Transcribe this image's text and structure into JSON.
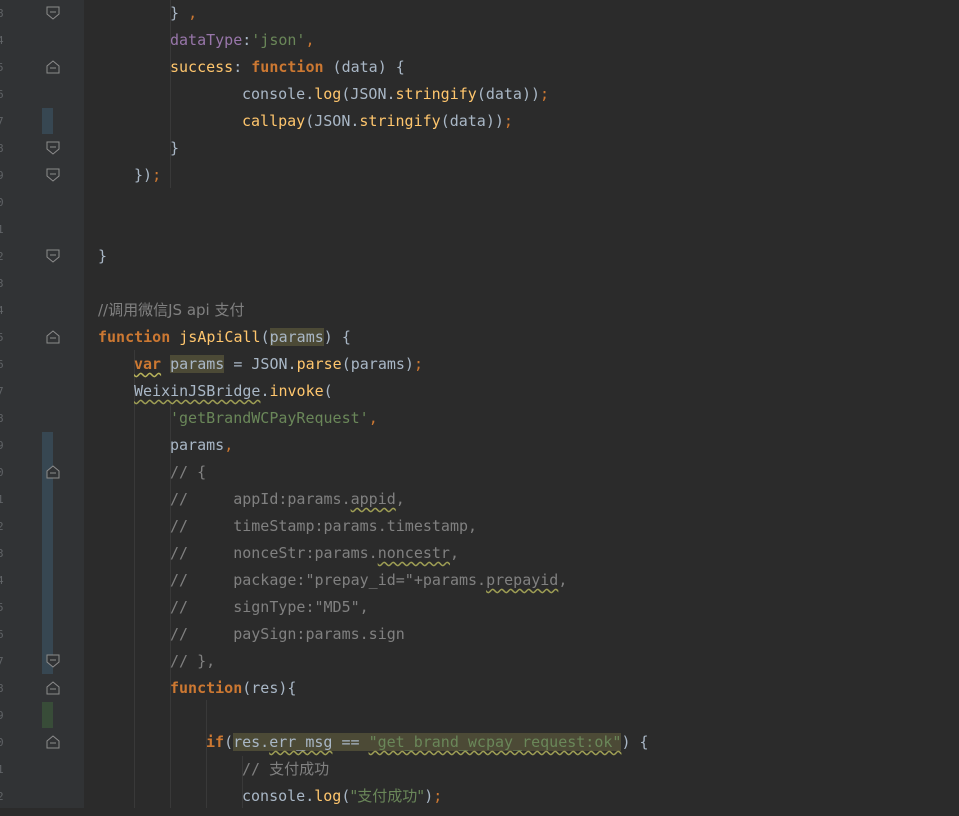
{
  "editor": {
    "lines": {
      "l1_brace": "} ",
      "l1_comma": ",",
      "l2_key": "dataType",
      "l2_colon": ":",
      "l2_val": "'json'",
      "l2_comma": ",",
      "l3_key": "success",
      "l3_colon": ": ",
      "l3_kw": "function",
      "l3_rest": " (data) {",
      "l4_a": "console.",
      "l4_fn": "log",
      "l4_b": "(JSON.",
      "l4_fn2": "stringify",
      "l4_c": "(data))",
      "l4_semi": ";",
      "l5_fn": "callpay",
      "l5_a": "(JSON.",
      "l5_fn2": "stringify",
      "l5_b": "(data))",
      "l5_semi": ";",
      "l6": "}",
      "l7_a": "})",
      "l7_semi": ";",
      "l10": "}",
      "l12": "//调用微信JS api 支付",
      "l13_kw": "function",
      "l13_fn": "jsApiCall",
      "l13_open": "(",
      "l13_param": "params",
      "l13_close": ") {",
      "l14_kw": "var",
      "l14_var": "params",
      "l14_a": " = JSON.",
      "l14_fn": "parse",
      "l14_b": "(params)",
      "l14_semi": ";",
      "l15_obj": "WeixinJSBridge",
      "l15_dot": ".",
      "l15_fn": "invoke",
      "l15_open": "(",
      "l16_str": "'getBrandWCPayRequest'",
      "l16_comma": ",",
      "l17_a": "params",
      "l17_comma": ",",
      "l18": "// {",
      "l19_a": "//     appId:params.",
      "l19_b": "appid",
      "l19_c": ",",
      "l20": "//     timeStamp:params.timestamp,",
      "l21_a": "//     nonceStr:params.",
      "l21_b": "noncestr",
      "l21_c": ",",
      "l22_a": "//     package:\"prepay_id=\"+params.",
      "l22_b": "prepayid",
      "l22_c": ",",
      "l23": "//     signType:\"MD5\",",
      "l24": "//     paySign:params.sign",
      "l25": "// },",
      "l26_kw": "function",
      "l26_rest": "(res){",
      "l28_kw": "if",
      "l28_open": "(",
      "l28_a": "res.",
      "l28_b": "err_msg",
      "l28_c": " == ",
      "l28_str": "\"get_brand_wcpay_request:ok\"",
      "l28_close": ") {",
      "l29_a": "// ",
      "l29_b": "支付成功",
      "l30_a": "console.",
      "l30_fn": "log",
      "l30_open": "(",
      "l30_str": "\"支付成功\"",
      "l30_close": ")",
      "l30_semi": ";"
    }
  },
  "colors": {
    "background": "#2b2b2b",
    "gutter": "#313335",
    "keyword": "#cc7832",
    "property": "#9876aa",
    "string": "#6a8759",
    "function": "#ffc66d",
    "comment": "#808080",
    "text": "#a9b7c6",
    "vcs_modified": "#374752",
    "vcs_added": "#384c38"
  }
}
